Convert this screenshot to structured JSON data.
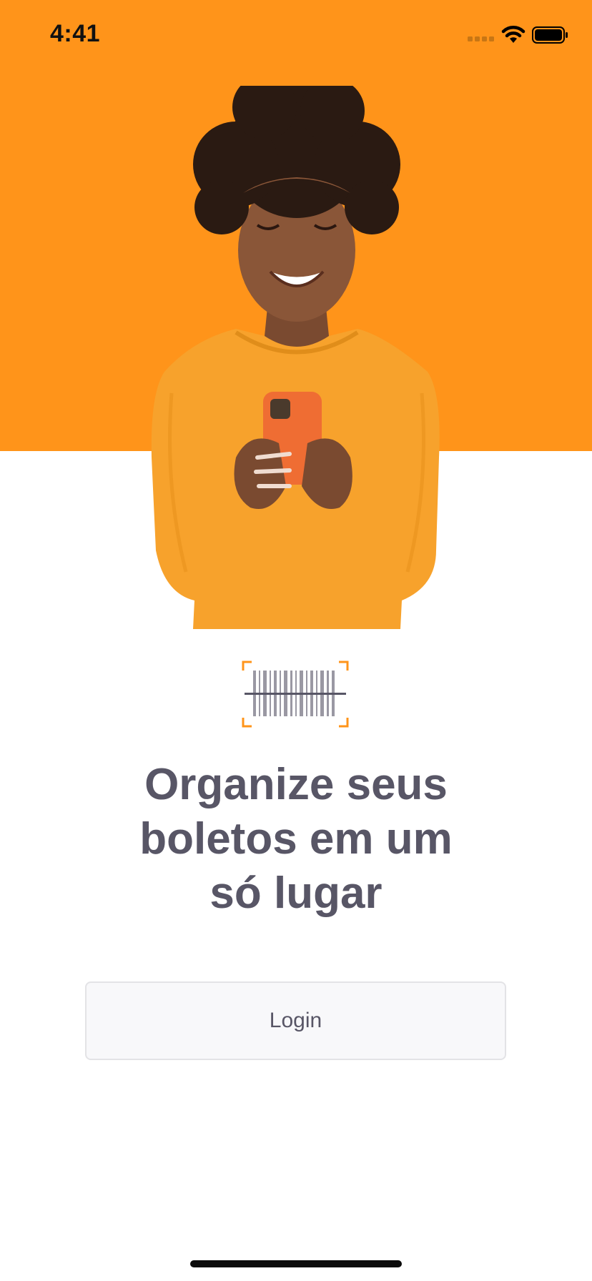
{
  "status_bar": {
    "time": "4:41",
    "icons": [
      "cellular-signal-icon",
      "wifi-icon",
      "battery-icon"
    ]
  },
  "hero": {
    "background_color": "#ff941a",
    "illustration": "smiling-woman-with-phone"
  },
  "logo": {
    "icon": "barcode-scan-icon",
    "accent_color": "#ff941a"
  },
  "headline": {
    "line1": "Organize seus",
    "line2": "boletos em um",
    "line3": "só lugar"
  },
  "login_button": {
    "label": "Login"
  }
}
